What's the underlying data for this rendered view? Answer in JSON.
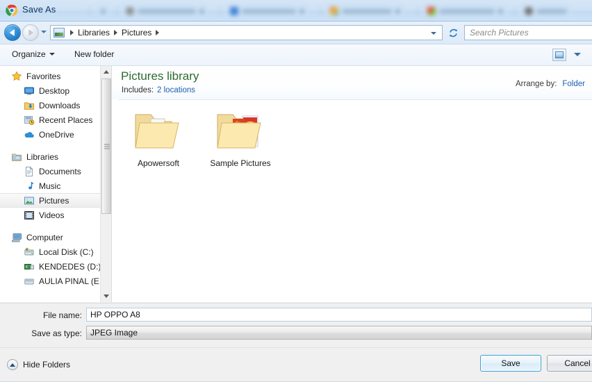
{
  "window": {
    "title": "Save As",
    "title_icon": "chrome-logo-icon"
  },
  "background_tabs": [
    {
      "title_width": 62
    },
    {
      "title_width": 84
    },
    {
      "title_width": 78
    },
    {
      "title_width": 72
    },
    {
      "title_width": 80
    },
    {
      "title_width": 44
    }
  ],
  "navigation": {
    "back_label": "Back",
    "forward_label": "Forward",
    "recent_pages_label": "Recent pages",
    "breadcrumb": [
      "Libraries",
      "Pictures"
    ],
    "breadcrumb_icon": "library-icon",
    "refresh_label": "Refresh",
    "previous_locations_label": "Previous locations"
  },
  "search": {
    "placeholder": "Search Pictures"
  },
  "toolbar": {
    "organize_label": "Organize",
    "new_folder_label": "New folder",
    "view_label": "Change your view",
    "view_icon": "view-mode-icon"
  },
  "sidebar": {
    "groups": [
      {
        "label": "Favorites",
        "icon": "star-icon",
        "items": [
          {
            "label": "Desktop",
            "icon": "desktop-icon"
          },
          {
            "label": "Downloads",
            "icon": "downloads-icon"
          },
          {
            "label": "Recent Places",
            "icon": "recent-places-icon"
          },
          {
            "label": "OneDrive",
            "icon": "onedrive-cloud-icon"
          }
        ]
      },
      {
        "label": "Libraries",
        "icon": "libraries-folder-icon",
        "items": [
          {
            "label": "Documents",
            "icon": "documents-icon",
            "selected": false
          },
          {
            "label": "Music",
            "icon": "music-note-icon",
            "selected": false
          },
          {
            "label": "Pictures",
            "icon": "pictures-icon",
            "selected": true
          },
          {
            "label": "Videos",
            "icon": "videos-film-icon",
            "selected": false
          }
        ]
      },
      {
        "label": "Computer",
        "icon": "computer-icon",
        "items": [
          {
            "label": "Local Disk (C:)",
            "icon": "system-drive-icon"
          },
          {
            "label": "KENDEDES (D:)",
            "icon": "drive-icon"
          },
          {
            "label": "AULIA PINAL (E:)",
            "icon": "drive-icon"
          }
        ]
      }
    ]
  },
  "content": {
    "library_title": "Pictures library",
    "includes_label": "Includes:",
    "includes_link": "2 locations",
    "arrange_label": "Arrange by:",
    "arrange_value": "Folder",
    "items": [
      {
        "label": "Apowersoft",
        "icon": "folder-icon"
      },
      {
        "label": "Sample Pictures",
        "icon": "folder-with-pictures-icon"
      }
    ]
  },
  "form": {
    "file_name_label": "File name:",
    "file_name_value": "HP OPPO A8",
    "save_as_type_label": "Save as type:",
    "save_as_type_value": "JPEG Image"
  },
  "footer": {
    "hide_folders_label": "Hide Folders",
    "hide_folders_icon": "chevron-up-circle-icon",
    "save_label": "Save",
    "cancel_label": "Cancel"
  },
  "colors": {
    "title_blue": "#11305c",
    "library_green": "#2e6b2e",
    "link_blue": "#1b5fb0",
    "default_button_border": "#3c9ed6"
  }
}
